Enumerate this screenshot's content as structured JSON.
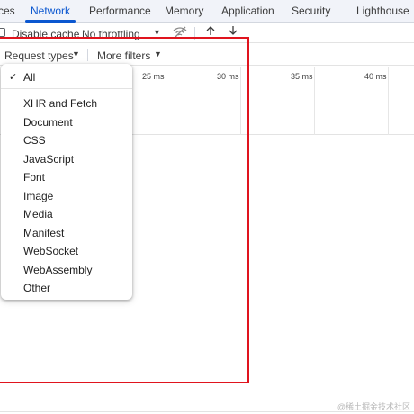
{
  "tabs": [
    {
      "label": "ces"
    },
    {
      "label": "Network",
      "active": true
    },
    {
      "label": "Performance"
    },
    {
      "label": "Memory"
    },
    {
      "label": "Application"
    },
    {
      "label": "Security"
    },
    {
      "label": "Lighthouse"
    }
  ],
  "toolbar": {
    "disable_cache_label": "Disable cache",
    "disable_cache_checked": false,
    "throttling_value": "No throttling"
  },
  "filters": {
    "request_types_label": "Request types",
    "more_filters_label": "More filters"
  },
  "timeline": {
    "ticks": [
      "25 ms",
      "30 ms",
      "35 ms",
      "40 ms"
    ]
  },
  "dropdown": {
    "items": [
      {
        "label": "All",
        "checked": true
      },
      {
        "label": "XHR and Fetch"
      },
      {
        "label": "Document"
      },
      {
        "label": "CSS"
      },
      {
        "label": "JavaScript"
      },
      {
        "label": "Font"
      },
      {
        "label": "Image"
      },
      {
        "label": "Media"
      },
      {
        "label": "Manifest"
      },
      {
        "label": "WebSocket"
      },
      {
        "label": "WebAssembly"
      },
      {
        "label": "Other"
      }
    ],
    "check_glyph": "✓"
  },
  "watermark": "@稀土掘金技术社区",
  "colors": {
    "accent": "#0b57d0",
    "highlight_border": "#e0141e"
  }
}
